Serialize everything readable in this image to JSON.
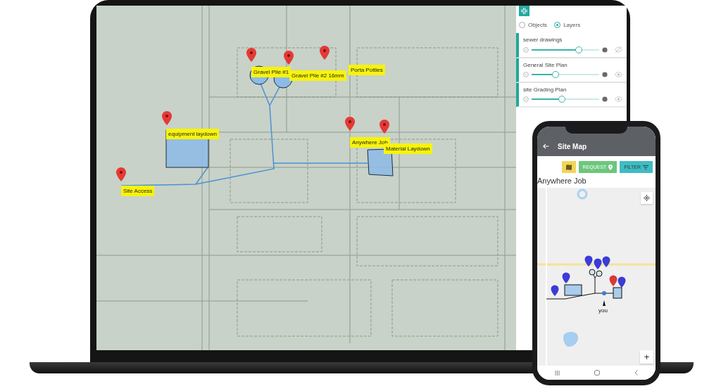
{
  "laptop": {
    "map": {
      "markers": [
        {
          "label": "Gravel Pile #1"
        },
        {
          "label": "Gravel Pile #2 16mm"
        },
        {
          "label": "Porta Potties"
        },
        {
          "label": "equipment laydown"
        },
        {
          "label": "Anywhere Job"
        },
        {
          "label": "Material Laydown"
        },
        {
          "label": "Site Access"
        }
      ]
    },
    "panel": {
      "view_options": [
        {
          "label": "Objects",
          "selected": false
        },
        {
          "label": "Layers",
          "selected": true
        }
      ],
      "layers": [
        {
          "name": "sewer drawings",
          "level": 0.7,
          "visible": false
        },
        {
          "name": "General Site Plan",
          "level": 0.35,
          "visible": true
        },
        {
          "name": "site Grading Plan",
          "level": 0.45,
          "visible": true
        }
      ]
    }
  },
  "phone": {
    "title": "Site Map",
    "buttons": [
      {
        "kind": "map"
      },
      {
        "kind": "request",
        "label": "REQUEST"
      },
      {
        "kind": "filter",
        "label": "FILTER"
      }
    ],
    "job_title": "Anywhere Job",
    "map": {
      "you_label": "you",
      "markers": [
        {
          "color": "#3b3bd6"
        },
        {
          "color": "#3b3bd6"
        },
        {
          "color": "#3b3bd6"
        },
        {
          "color": "#3b3bd6"
        },
        {
          "color": "#3b3bd6"
        },
        {
          "color": "#d93a35"
        },
        {
          "color": "#3b3bd6"
        }
      ]
    },
    "zoom_in": "+"
  }
}
